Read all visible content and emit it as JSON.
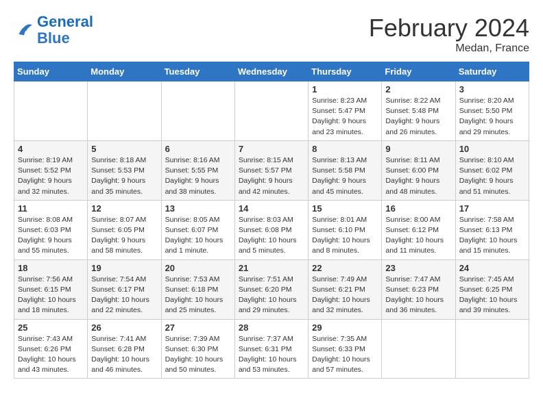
{
  "header": {
    "logo_general": "General",
    "logo_blue": "Blue",
    "title": "February 2024",
    "subtitle": "Medan, France"
  },
  "calendar": {
    "days_of_week": [
      "Sunday",
      "Monday",
      "Tuesday",
      "Wednesday",
      "Thursday",
      "Friday",
      "Saturday"
    ],
    "weeks": [
      [
        {
          "day": "",
          "info": ""
        },
        {
          "day": "",
          "info": ""
        },
        {
          "day": "",
          "info": ""
        },
        {
          "day": "",
          "info": ""
        },
        {
          "day": "1",
          "info": "Sunrise: 8:23 AM\nSunset: 5:47 PM\nDaylight: 9 hours\nand 23 minutes."
        },
        {
          "day": "2",
          "info": "Sunrise: 8:22 AM\nSunset: 5:48 PM\nDaylight: 9 hours\nand 26 minutes."
        },
        {
          "day": "3",
          "info": "Sunrise: 8:20 AM\nSunset: 5:50 PM\nDaylight: 9 hours\nand 29 minutes."
        }
      ],
      [
        {
          "day": "4",
          "info": "Sunrise: 8:19 AM\nSunset: 5:52 PM\nDaylight: 9 hours\nand 32 minutes."
        },
        {
          "day": "5",
          "info": "Sunrise: 8:18 AM\nSunset: 5:53 PM\nDaylight: 9 hours\nand 35 minutes."
        },
        {
          "day": "6",
          "info": "Sunrise: 8:16 AM\nSunset: 5:55 PM\nDaylight: 9 hours\nand 38 minutes."
        },
        {
          "day": "7",
          "info": "Sunrise: 8:15 AM\nSunset: 5:57 PM\nDaylight: 9 hours\nand 42 minutes."
        },
        {
          "day": "8",
          "info": "Sunrise: 8:13 AM\nSunset: 5:58 PM\nDaylight: 9 hours\nand 45 minutes."
        },
        {
          "day": "9",
          "info": "Sunrise: 8:11 AM\nSunset: 6:00 PM\nDaylight: 9 hours\nand 48 minutes."
        },
        {
          "day": "10",
          "info": "Sunrise: 8:10 AM\nSunset: 6:02 PM\nDaylight: 9 hours\nand 51 minutes."
        }
      ],
      [
        {
          "day": "11",
          "info": "Sunrise: 8:08 AM\nSunset: 6:03 PM\nDaylight: 9 hours\nand 55 minutes."
        },
        {
          "day": "12",
          "info": "Sunrise: 8:07 AM\nSunset: 6:05 PM\nDaylight: 9 hours\nand 58 minutes."
        },
        {
          "day": "13",
          "info": "Sunrise: 8:05 AM\nSunset: 6:07 PM\nDaylight: 10 hours\nand 1 minute."
        },
        {
          "day": "14",
          "info": "Sunrise: 8:03 AM\nSunset: 6:08 PM\nDaylight: 10 hours\nand 5 minutes."
        },
        {
          "day": "15",
          "info": "Sunrise: 8:01 AM\nSunset: 6:10 PM\nDaylight: 10 hours\nand 8 minutes."
        },
        {
          "day": "16",
          "info": "Sunrise: 8:00 AM\nSunset: 6:12 PM\nDaylight: 10 hours\nand 11 minutes."
        },
        {
          "day": "17",
          "info": "Sunrise: 7:58 AM\nSunset: 6:13 PM\nDaylight: 10 hours\nand 15 minutes."
        }
      ],
      [
        {
          "day": "18",
          "info": "Sunrise: 7:56 AM\nSunset: 6:15 PM\nDaylight: 10 hours\nand 18 minutes."
        },
        {
          "day": "19",
          "info": "Sunrise: 7:54 AM\nSunset: 6:17 PM\nDaylight: 10 hours\nand 22 minutes."
        },
        {
          "day": "20",
          "info": "Sunrise: 7:53 AM\nSunset: 6:18 PM\nDaylight: 10 hours\nand 25 minutes."
        },
        {
          "day": "21",
          "info": "Sunrise: 7:51 AM\nSunset: 6:20 PM\nDaylight: 10 hours\nand 29 minutes."
        },
        {
          "day": "22",
          "info": "Sunrise: 7:49 AM\nSunset: 6:21 PM\nDaylight: 10 hours\nand 32 minutes."
        },
        {
          "day": "23",
          "info": "Sunrise: 7:47 AM\nSunset: 6:23 PM\nDaylight: 10 hours\nand 36 minutes."
        },
        {
          "day": "24",
          "info": "Sunrise: 7:45 AM\nSunset: 6:25 PM\nDaylight: 10 hours\nand 39 minutes."
        }
      ],
      [
        {
          "day": "25",
          "info": "Sunrise: 7:43 AM\nSunset: 6:26 PM\nDaylight: 10 hours\nand 43 minutes."
        },
        {
          "day": "26",
          "info": "Sunrise: 7:41 AM\nSunset: 6:28 PM\nDaylight: 10 hours\nand 46 minutes."
        },
        {
          "day": "27",
          "info": "Sunrise: 7:39 AM\nSunset: 6:30 PM\nDaylight: 10 hours\nand 50 minutes."
        },
        {
          "day": "28",
          "info": "Sunrise: 7:37 AM\nSunset: 6:31 PM\nDaylight: 10 hours\nand 53 minutes."
        },
        {
          "day": "29",
          "info": "Sunrise: 7:35 AM\nSunset: 6:33 PM\nDaylight: 10 hours\nand 57 minutes."
        },
        {
          "day": "",
          "info": ""
        },
        {
          "day": "",
          "info": ""
        }
      ]
    ]
  }
}
